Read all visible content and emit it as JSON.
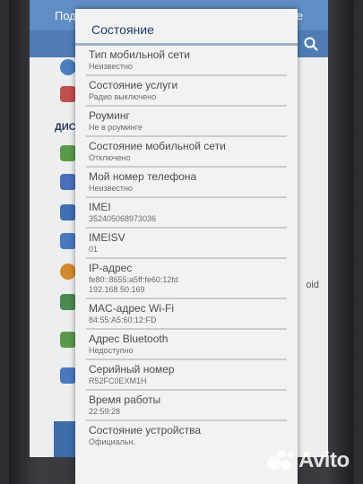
{
  "background_app": {
    "topbar_left": "Под",
    "topbar_right": "не",
    "section_label": "ДИС",
    "side_text": "oid"
  },
  "dialog": {
    "title": "Состояние",
    "items": [
      {
        "title": "Тип мобильной сети",
        "value": "Неизвестно"
      },
      {
        "title": "Состояние услуги",
        "value": "Радио выключено"
      },
      {
        "title": "Роуминг",
        "value": "Не в роуминге"
      },
      {
        "title": "Состояние мобильной сети",
        "value": "Отключено"
      },
      {
        "title": "Мой номер телефона",
        "value": "Неизвестно"
      },
      {
        "title": "IMEI",
        "value": "352405068973036"
      },
      {
        "title": "IMEISV",
        "value": "01"
      },
      {
        "title": "IP-адрес",
        "value": "fe80::8655:a5ff:fe60:12fd",
        "value2": "192.168.50.169"
      },
      {
        "title": "MAC-адрес Wi-Fi",
        "value": "84:55:A5:60:12:FD"
      },
      {
        "title": "Адрес Bluetooth",
        "value": "Недоступно"
      },
      {
        "title": "Серийный номер",
        "value": "R52FC0EXM1H"
      },
      {
        "title": "Время работы",
        "value": "22:59:28"
      },
      {
        "title": "Состояние устройства",
        "value": "Официальн."
      }
    ]
  },
  "watermark": {
    "text": "Avito"
  },
  "colors": {
    "accent": "#5f8ec4",
    "title": "#1c3c66",
    "divider": "#cbcccf"
  }
}
